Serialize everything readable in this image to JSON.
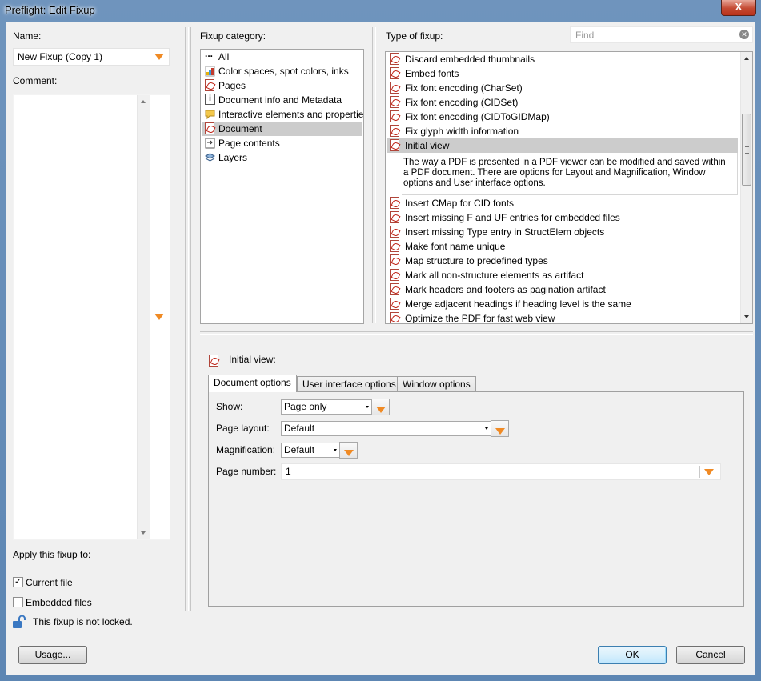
{
  "window": {
    "title": "Preflight: Edit Fixup",
    "close_label": "X"
  },
  "left": {
    "name_label": "Name:",
    "name_value": "New Fixup (Copy 1)",
    "comment_label": "Comment:",
    "comment_value": "",
    "apply_label": "Apply this fixup to:",
    "current_file_label": "Current file",
    "current_file_checked": true,
    "embedded_files_label": "Embedded files",
    "embedded_files_checked": false,
    "lock_label": "This fixup is not locked."
  },
  "category": {
    "label": "Fixup category:",
    "items": [
      {
        "label": "All",
        "icon": "ellipsis-icon"
      },
      {
        "label": "Color spaces, spot colors, inks",
        "icon": "color-icon"
      },
      {
        "label": "Pages",
        "icon": "pdf-page-icon"
      },
      {
        "label": "Document info and Metadata",
        "icon": "info-icon"
      },
      {
        "label": "Interactive elements and properties",
        "icon": "comment-icon"
      },
      {
        "label": "Document",
        "icon": "pdf-page-icon",
        "selected": true
      },
      {
        "label": "Page contents",
        "icon": "page-contents-icon"
      },
      {
        "label": "Layers",
        "icon": "layers-icon"
      }
    ]
  },
  "fixups": {
    "label": "Type of fixup:",
    "search_placeholder": "Find",
    "items": [
      {
        "label": "Discard embedded thumbnails"
      },
      {
        "label": "Embed fonts"
      },
      {
        "label": "Fix font encoding (CharSet)"
      },
      {
        "label": "Fix font encoding (CIDSet)"
      },
      {
        "label": "Fix font encoding (CIDToGIDMap)"
      },
      {
        "label": "Fix glyph width information"
      },
      {
        "label": "Initial view",
        "selected": true
      },
      {
        "label": "Insert CMap for CID fonts"
      },
      {
        "label": "Insert missing F and UF entries for embedded files"
      },
      {
        "label": "Insert missing Type entry in StructElem objects"
      },
      {
        "label": "Make font name unique"
      },
      {
        "label": "Map structure to predefined types"
      },
      {
        "label": "Mark all non-structure elements as artifact"
      },
      {
        "label": "Mark headers and footers as pagination artifact"
      },
      {
        "label": "Merge adjacent headings if heading level is the same"
      },
      {
        "label": "Optimize the PDF for fast web view"
      }
    ],
    "selected_description": "The way a PDF is presented in a PDF viewer can be modified and saved within a PDF document. There are options for Layout and Magnification, Window options and User interface options."
  },
  "detail": {
    "header": "Initial view:",
    "tabs": [
      "Document options",
      "User interface options",
      "Window options"
    ],
    "show_label": "Show:",
    "show_value": "Page only",
    "layout_label": "Page layout:",
    "layout_value": "Default",
    "magnification_label": "Magnification:",
    "magnification_value": "Default",
    "page_number_label": "Page number:",
    "page_number_value": "1"
  },
  "buttons": {
    "usage": "Usage...",
    "ok": "OK",
    "cancel": "Cancel"
  }
}
